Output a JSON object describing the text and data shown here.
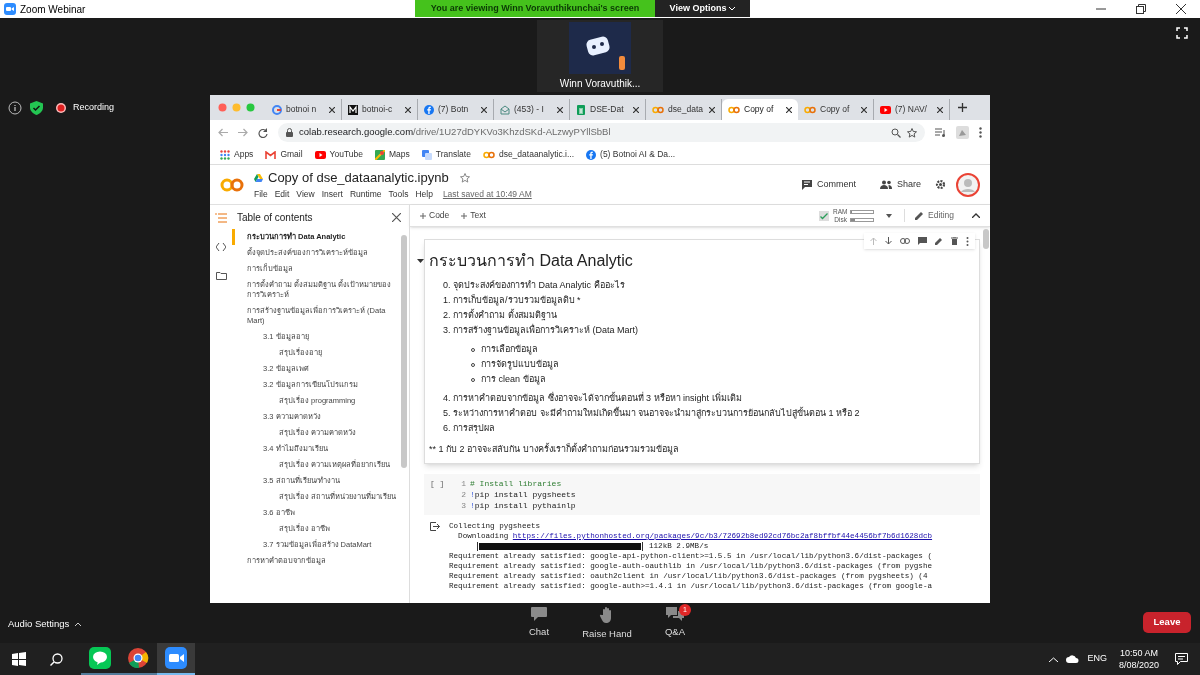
{
  "zoom_window": {
    "title": "Zoom Webinar",
    "banner": "You are viewing Winn Voravuthikunchai's screen",
    "view_options": "View Options",
    "participant_name": "Winn Voravuthik...",
    "recording": "Recording"
  },
  "browser": {
    "tabs": [
      {
        "label": "botnoi n",
        "kind": "google",
        "selected": false
      },
      {
        "label": "botnoi-c",
        "kind": "medium",
        "selected": false
      },
      {
        "label": "(7) Botn",
        "kind": "facebook",
        "selected": false
      },
      {
        "label": "(453) - I",
        "kind": "mail",
        "selected": false
      },
      {
        "label": "DSE-Dat",
        "kind": "sheets",
        "selected": false
      },
      {
        "label": "dse_data",
        "kind": "colab",
        "selected": false
      },
      {
        "label": "Copy of",
        "kind": "colab",
        "selected": true
      },
      {
        "label": "Copy of",
        "kind": "colab",
        "selected": false
      },
      {
        "label": "(7) NAV/",
        "kind": "youtube",
        "selected": false
      }
    ],
    "url_host": "colab.research.google.com",
    "url_path": "/drive/1U27dDYKVo3KhzdSKd-ALzwyPYllSbBl",
    "bookmarks": [
      {
        "label": "Apps",
        "kind": "apps"
      },
      {
        "label": "Gmail",
        "kind": "gmail"
      },
      {
        "label": "YouTube",
        "kind": "youtube"
      },
      {
        "label": "Maps",
        "kind": "maps"
      },
      {
        "label": "Translate",
        "kind": "translate"
      },
      {
        "label": "dse_dataanalytic.i...",
        "kind": "colab"
      },
      {
        "label": "(5) Botnoi AI & Da...",
        "kind": "facebook"
      }
    ]
  },
  "colab": {
    "title": "Copy of dse_dataanalytic.ipynb",
    "menu": [
      "File",
      "Edit",
      "View",
      "Insert",
      "Runtime",
      "Tools",
      "Help"
    ],
    "last_saved": "Last saved at 10:49 AM",
    "comment": "Comment",
    "share": "Share",
    "toolbar": {
      "add_code": "Code",
      "add_text": "Text",
      "ram_label": "RAM",
      "ram": {
        "level": 0.05
      },
      "disk_label": "Disk",
      "disk": {
        "level": 0.2
      },
      "mode": "Editing"
    },
    "toc": {
      "title": "Table of contents",
      "items": [
        {
          "label": "กระบวนการทำ Data Analytic",
          "selected": true
        },
        {
          "label": "ตั้งจุดประสงค์ของการวิเคราะห์ข้อมูล",
          "selected": false
        },
        {
          "label": "การเก็บข้อมูล",
          "selected": false
        },
        {
          "label": "การตั้งคำถาม ตั้งสมมติฐาน ตั้งเป้าหมายของการวิเคราะห์",
          "selected": false
        },
        {
          "label": "การสร้างฐานข้อมูลเพื่อการวิเคราะห์ (Data Mart)",
          "selected": false,
          "children": [
            {
              "label": "3.1 ข้อมูลอายุ",
              "selected": false,
              "children": [
                {
                  "label": "สรุปเรื่องอายุ",
                  "selected": false
                }
              ]
            },
            {
              "label": "3.2 ข้อมูลเพศ",
              "selected": false
            },
            {
              "label": "3.2 ข้อมูลการเขียนโปรแกรม",
              "selected": false,
              "children": [
                {
                  "label": "สรุปเรื่อง programming",
                  "selected": false
                }
              ]
            },
            {
              "label": "3.3 ความคาดหวัง",
              "selected": false,
              "children": [
                {
                  "label": "สรุปเรื่อง ความคาดหวัง",
                  "selected": false
                }
              ]
            },
            {
              "label": "3.4 ทำไมถึงมาเรียน",
              "selected": false,
              "children": [
                {
                  "label": "สรุปเรื่อง ความเหตุผลที่อยากเรียน",
                  "selected": false
                }
              ]
            },
            {
              "label": "3.5 สถานที่เรียน/ทำงาน",
              "selected": false,
              "children": [
                {
                  "label": "สรุปเรื่อง สถานที่หน่วยงานที่มาเรียน",
                  "selected": false
                }
              ]
            },
            {
              "label": "3.6 อาชีพ",
              "selected": false,
              "children": [
                {
                  "label": "สรุปเรื่อง อาชีพ",
                  "selected": false
                }
              ]
            },
            {
              "label": "3.7 รวมข้อมูลเพื่อสร้าง DataMart",
              "selected": false
            }
          ]
        },
        {
          "label": "การหาคำตอบจากข้อมูล",
          "selected": false
        }
      ]
    },
    "text_cell": {
      "heading": "กระบวนการทำ Data Analytic",
      "items": [
        {
          "text": "0. จุดประสงค์ของการทำ Data Analytic คืออะไร"
        },
        {
          "text": "1. การเก็บข้อมูล/รวบรวมข้อมูลดิบ *"
        },
        {
          "text": "2. การตั้งคำถาม ตั้งสมมติฐาน"
        },
        {
          "text": "3. การสร้างฐานข้อมูลเพื่อการวิเคราะห์ (Data Mart)",
          "bullets": [
            "การเลือกข้อมูล",
            "การจัดรูปแบบข้อมูล",
            "การ clean ข้อมูล"
          ]
        },
        {
          "text": "4. การหาคำตอบจากข้อมูล ซึ่งอาจจะได้จากขั้นตอนที่ 3 หรือหา insight เพิ่มเติม"
        },
        {
          "text": "5. ระหว่างการหาคำตอบ จะมีคำถามใหม่เกิดขึ้นมา จนอาจจะนำมาสู่กระบวนการย้อนกลับไปสู่ขั้นตอน 1 หรือ 2"
        },
        {
          "text": "6. การสรุปผล"
        }
      ],
      "note": "** 1 กับ 2 อาจจะสลับกัน บางครั้งเราก็ตั้งคำถามก่อนรวมรวมข้อมูล"
    },
    "code_cell": {
      "run": "[ ]",
      "lines": [
        {
          "number": "1",
          "kind": "comment",
          "code": "# Install libraries"
        },
        {
          "number": "2",
          "kind": "shell",
          "bang": "!",
          "code": "pip install pygsheets"
        },
        {
          "number": "3",
          "kind": "shell",
          "bang": "!",
          "code": "pip install pythainlp"
        }
      ]
    },
    "output": {
      "lines": [
        {
          "kind": "text",
          "text": "Collecting pygsheets"
        },
        {
          "kind": "link",
          "text": "  Downloading ",
          "link": "https://files.pythonhosted.org/packages/9c/b3/72692b8ed92cd76bc2af8bffbf44e4456bf7b6d1628dcb"
        },
        {
          "kind": "progress",
          "level": 1,
          "text": "112kB 2.9MB/s"
        },
        {
          "kind": "text",
          "text": "Requirement already satisfied: google-api-python-client>=1.5.5 in /usr/local/lib/python3.6/dist-packages ("
        },
        {
          "kind": "text",
          "text": "Requirement already satisfied: google-auth-oauthlib in /usr/local/lib/python3.6/dist-packages (from pygshe"
        },
        {
          "kind": "text",
          "text": "Requirement already satisfied: oauth2client in /usr/local/lib/python3.6/dist-packages (from pygsheets) (4"
        },
        {
          "kind": "text",
          "text": "Requirement already satisfied: google-auth>=1.4.1 in /usr/local/lib/python3.6/dist-packages (from google-a"
        }
      ]
    }
  },
  "zoom_controls": {
    "audio": "Audio Settings",
    "buttons": [
      {
        "label": "Chat",
        "kind": "chat"
      },
      {
        "label": "Raise Hand",
        "kind": "hand"
      },
      {
        "label": "Q&A",
        "kind": "qa",
        "badge": "1"
      }
    ],
    "leave": "Leave"
  },
  "taskbar": {
    "apps": [
      {
        "kind": "line",
        "selected": false
      },
      {
        "kind": "chrome",
        "selected": false
      },
      {
        "kind": "zoom",
        "selected": true
      }
    ],
    "language": "ENG",
    "time": "10:50 AM",
    "date": "8/08/2020"
  }
}
